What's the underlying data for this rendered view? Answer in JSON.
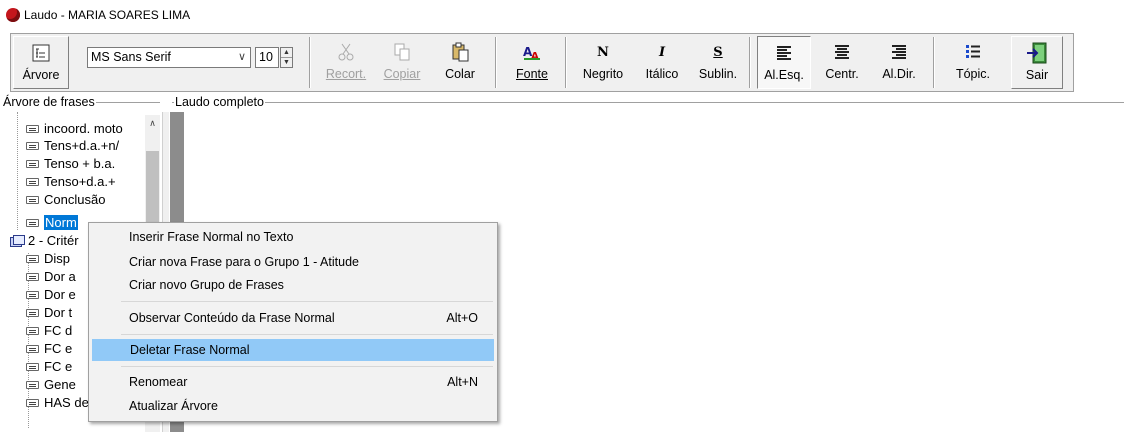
{
  "window": {
    "title": "Laudo - MARIA SOARES LIMA",
    "icon": "app-logo-icon"
  },
  "toolbar": {
    "arvore": "Árvore",
    "font_name": "MS Sans Serif",
    "font_size": "10",
    "recortar": "Recort.",
    "copiar": "Copiar",
    "colar": "Colar",
    "fonte": "Fonte",
    "negrito": "Negrito",
    "italico": "Itálico",
    "sublinhado": "Sublin.",
    "al_esq": "Al.Esq.",
    "centr": "Centr.",
    "al_dir": "Al.Dir.",
    "topic": "Tópic.",
    "sair": "Sair",
    "negrito_glyph": "N",
    "italico_glyph": "I",
    "sublin_glyph": "S"
  },
  "panels": {
    "tree_title": "Árvore de frases",
    "laudo_title": "Laudo completo"
  },
  "tree": {
    "items": [
      {
        "label": "incoord. moto",
        "type": "leaf"
      },
      {
        "label": "Tens+d.a.+n/",
        "type": "leaf"
      },
      {
        "label": "Tenso + b.a.",
        "type": "leaf"
      },
      {
        "label": "Tenso+d.a.+",
        "type": "leaf"
      },
      {
        "label": "Conclusão",
        "type": "leaf"
      },
      {
        "label": "Norm",
        "type": "leaf",
        "selected": true
      },
      {
        "label": "2 - Critér",
        "type": "group"
      },
      {
        "label": "Disp",
        "type": "leaf"
      },
      {
        "label": "Dor a",
        "type": "leaf"
      },
      {
        "label": "Dor e",
        "type": "leaf"
      },
      {
        "label": "Dor t",
        "type": "leaf"
      },
      {
        "label": "FC d",
        "type": "leaf"
      },
      {
        "label": "FC e",
        "type": "leaf"
      },
      {
        "label": "FC e",
        "type": "leaf"
      },
      {
        "label": "Gene",
        "type": "leaf"
      },
      {
        "label": "HAS de repo",
        "type": "leaf"
      }
    ]
  },
  "context_menu": {
    "items": [
      {
        "label": "Inserir Frase Normal no Texto",
        "shortcut": ""
      },
      {
        "label": "Criar nova Frase para o Grupo 1 - Atitude",
        "shortcut": ""
      },
      {
        "label": "Criar novo Grupo de Frases",
        "shortcut": ""
      },
      {
        "label": "Observar Conteúdo da Frase Normal",
        "shortcut": "Alt+O"
      },
      {
        "label": "Deletar Frase Normal",
        "shortcut": "",
        "highlighted": true
      },
      {
        "label": "Renomear",
        "shortcut": "Alt+N"
      },
      {
        "label": "Atualizar Árvore",
        "shortcut": ""
      }
    ]
  },
  "colors": {
    "selection": "#0078d7",
    "menu_highlight": "#91c9f7",
    "gray_margin": "#8c8c8c"
  }
}
